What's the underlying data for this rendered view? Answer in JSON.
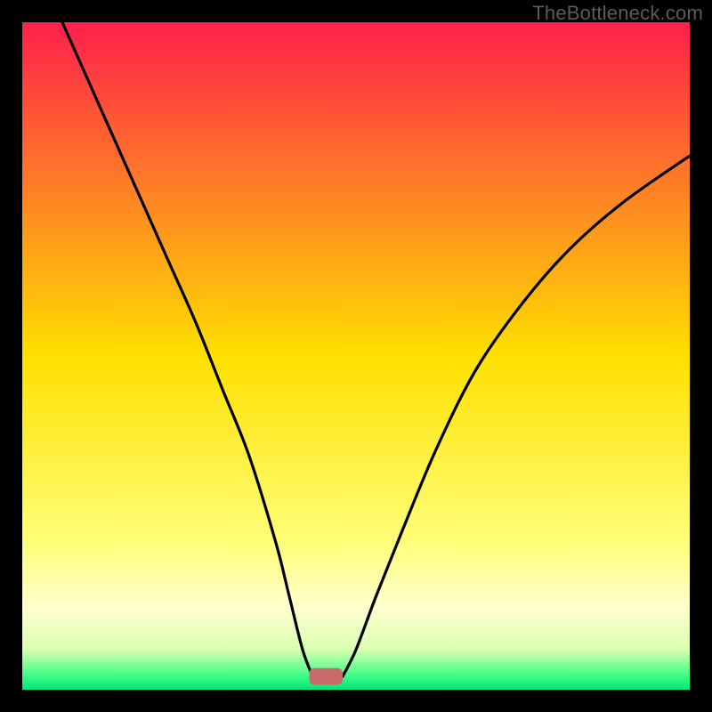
{
  "watermark": {
    "text": "TheBottleneck.com"
  },
  "chart_data": {
    "type": "line",
    "title": "",
    "xlabel": "",
    "ylabel": "",
    "xlim": [
      0,
      100
    ],
    "ylim": [
      0,
      100
    ],
    "background_gradient": {
      "stops": [
        {
          "offset": 0.0,
          "color": "#ff1f4b"
        },
        {
          "offset": 0.5,
          "color": "#ffe000"
        },
        {
          "offset": 0.78,
          "color": "#ffff7a"
        },
        {
          "offset": 0.88,
          "color": "#ffffd0"
        },
        {
          "offset": 0.94,
          "color": "#d8ffb0"
        },
        {
          "offset": 0.975,
          "color": "#4dff8a"
        },
        {
          "offset": 1.0,
          "color": "#00e477"
        }
      ]
    },
    "series": [
      {
        "name": "left-branch",
        "x": [
          6,
          10,
          14,
          18,
          22,
          26,
          30,
          34,
          38,
          40,
          42,
          43.5
        ],
        "y": [
          100,
          91,
          82,
          73,
          64,
          55,
          45,
          35,
          22,
          14,
          6,
          2
        ]
      },
      {
        "name": "right-branch",
        "x": [
          48,
          50,
          53,
          57,
          62,
          68,
          75,
          82,
          90,
          100
        ],
        "y": [
          2,
          6,
          14,
          24,
          36,
          48,
          58,
          66,
          73,
          80
        ]
      }
    ],
    "marker": {
      "name": "optimal-bar",
      "x_center": 45.5,
      "y": 2,
      "width": 5,
      "height": 2.5,
      "color": "#c96a6a"
    }
  }
}
